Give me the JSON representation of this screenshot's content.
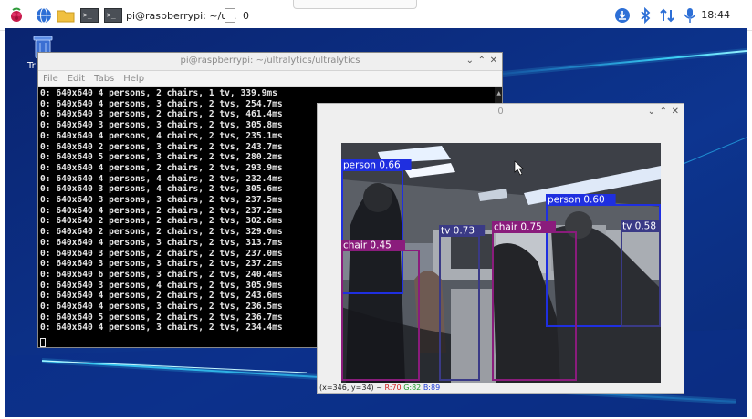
{
  "taskbar": {
    "terminal_task_label": "pi@raspberrypi: ~/ul..",
    "viewer_task_label": "0",
    "clock": "18:44"
  },
  "desktop": {
    "trash_label": "Tr"
  },
  "terminal": {
    "title": "pi@raspberrypi: ~/ultralytics/ultralytics",
    "menu": [
      "File",
      "Edit",
      "Tabs",
      "Help"
    ],
    "lines": [
      "0: 640x640 4 persons, 2 chairs, 1 tv, 339.9ms",
      "0: 640x640 4 persons, 3 chairs, 2 tvs, 254.7ms",
      "0: 640x640 3 persons, 2 chairs, 2 tvs, 461.4ms",
      "0: 640x640 3 persons, 3 chairs, 2 tvs, 305.8ms",
      "0: 640x640 4 persons, 4 chairs, 2 tvs, 235.1ms",
      "0: 640x640 2 persons, 3 chairs, 2 tvs, 243.7ms",
      "0: 640x640 5 persons, 3 chairs, 2 tvs, 280.2ms",
      "0: 640x640 4 persons, 2 chairs, 2 tvs, 293.9ms",
      "0: 640x640 4 persons, 4 chairs, 2 tvs, 232.4ms",
      "0: 640x640 3 persons, 4 chairs, 2 tvs, 305.6ms",
      "0: 640x640 3 persons, 3 chairs, 2 tvs, 237.5ms",
      "0: 640x640 4 persons, 2 chairs, 2 tvs, 237.2ms",
      "0: 640x640 2 persons, 2 chairs, 2 tvs, 302.6ms",
      "0: 640x640 2 persons, 2 chairs, 2 tvs, 329.0ms",
      "0: 640x640 4 persons, 3 chairs, 2 tvs, 313.7ms",
      "0: 640x640 3 persons, 2 chairs, 2 tvs, 237.0ms",
      "0: 640x640 3 persons, 3 chairs, 2 tvs, 237.2ms",
      "0: 640x640 6 persons, 3 chairs, 2 tvs, 240.4ms",
      "0: 640x640 3 persons, 4 chairs, 2 tvs, 305.9ms",
      "0: 640x640 4 persons, 2 chairs, 2 tvs, 243.6ms",
      "0: 640x640 4 persons, 3 chairs, 2 tvs, 236.5ms",
      "0: 640x640 5 persons, 2 chairs, 2 tvs, 236.7ms",
      "0: 640x640 4 persons, 3 chairs, 2 tvs, 234.4ms"
    ]
  },
  "viewer": {
    "title": "0",
    "status_coords": "(x=346, y=34) ~",
    "status_r": "R:70",
    "status_g": "G:82",
    "status_b": "B:89",
    "colors": {
      "person": "#1f2fe0",
      "chair": "#8a1c7c",
      "tv": "#3a3a86"
    },
    "detections": [
      {
        "label": "person 0.66",
        "class": "person"
      },
      {
        "label": "person 0.60",
        "class": "person"
      },
      {
        "label": "chair 0.45",
        "class": "chair"
      },
      {
        "label": "chair 0.75",
        "class": "chair"
      },
      {
        "label": "tv 0.73",
        "class": "tv"
      },
      {
        "label": "tv 0.58",
        "class": "tv"
      }
    ]
  }
}
